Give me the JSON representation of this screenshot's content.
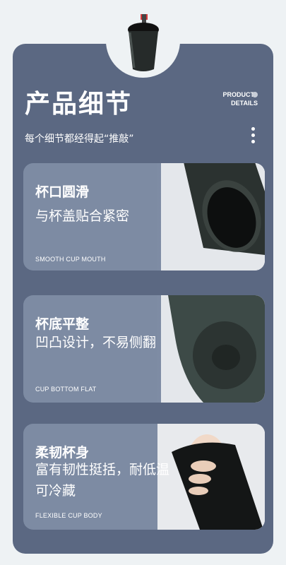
{
  "header": {
    "title": "产品细节",
    "badge_line1": "PRODUCT",
    "badge_line2": "DETAILS",
    "subtitle": "每个细节都经得起“推敲”"
  },
  "features": [
    {
      "title": "杯口圆滑",
      "desc": "与杯盖贴合紧密",
      "en": "SMOOTH CUP MOUTH"
    },
    {
      "title": "杯底平整",
      "desc": "凹凸设计，不易侧翻",
      "en": "CUP BOTTOM FLAT"
    },
    {
      "title": "柔韧杯身",
      "desc": "富有韧性挺括，耐低温可冷藏",
      "en": "FLEXIBLE CUP BODY"
    }
  ],
  "colors": {
    "panel_bg": "#5b6882",
    "feature_bg": "#7d8ba3",
    "cup": "#2a302e"
  },
  "icons": [
    "more-vertical-icon",
    "cup-icon"
  ]
}
